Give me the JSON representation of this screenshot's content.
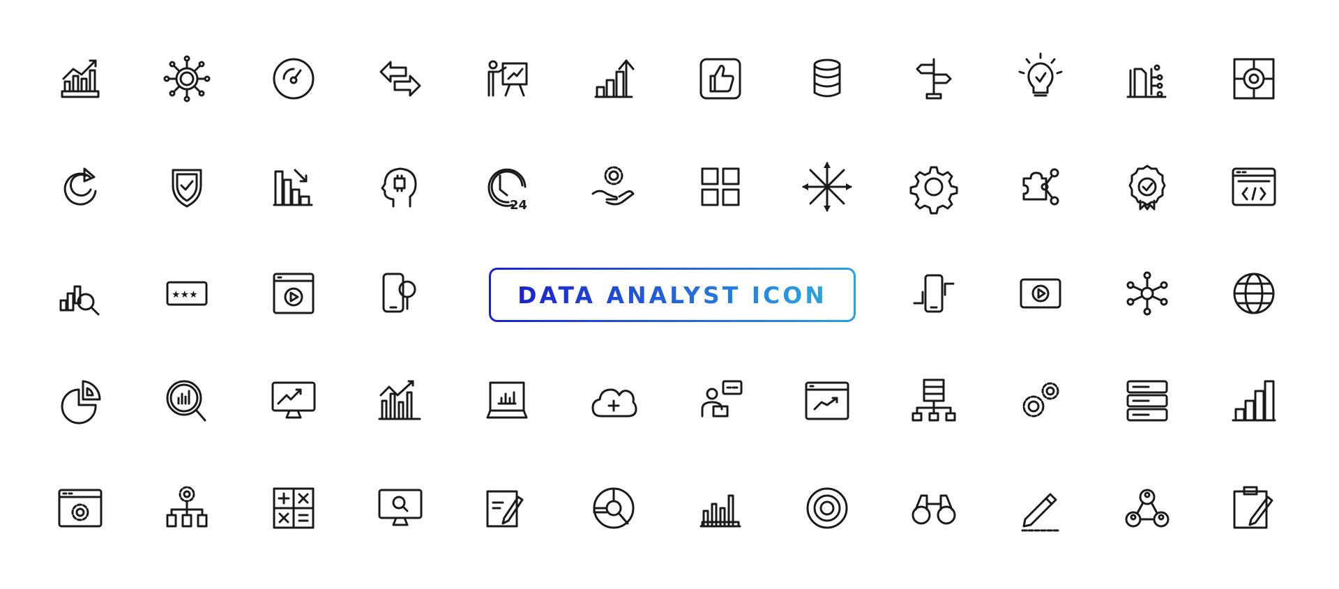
{
  "banner": {
    "title": "DATA ANALYST ICON",
    "gradient_start": "#1a22d0",
    "gradient_end": "#2aa6e3"
  },
  "icon_color": "#1a1a1a",
  "rows": [
    [
      "growth-chart-icon",
      "network-hub-icon",
      "speedometer-icon",
      "exchange-arrows-icon",
      "presentation-icon",
      "bar-growth-icon",
      "thumbs-up-icon",
      "database-icon",
      "signpost-icon",
      "idea-bulb-icon",
      "data-flow-icon",
      "target-frame-icon"
    ],
    [
      "refresh-icon",
      "shield-check-icon",
      "declining-chart-icon",
      "ai-head-icon",
      "support-24-icon",
      "hand-gear-icon",
      "grid-apps-icon",
      "expand-arrows-icon",
      "settings-gear-icon",
      "puzzle-share-icon",
      "quality-badge-icon",
      "code-window-icon"
    ],
    [
      "bar-search-icon",
      "rating-stars-icon",
      "video-window-icon",
      "mobile-search-icon",
      null,
      null,
      null,
      null,
      "mobile-sync-icon",
      "play-button-icon",
      "network-nodes-icon",
      "globe-icon"
    ],
    [
      "pie-chart-icon",
      "chart-search-icon",
      "monitor-chart-icon",
      "bar-trend-icon",
      "laptop-chart-icon",
      "cloud-add-icon",
      "user-chat-icon",
      "browser-chart-icon",
      "hierarchy-icon",
      "gears-icon",
      "server-stack-icon",
      "bar-steps-icon"
    ],
    [
      "browser-settings-icon",
      "gear-hierarchy-icon",
      "calculator-icon",
      "monitor-search-icon",
      "document-edit-icon",
      "donut-chart-icon",
      "bar-chart-icon",
      "target-icon",
      "binoculars-icon",
      "pencil-icon",
      "team-network-icon",
      "clipboard-edit-icon"
    ]
  ],
  "texts": {
    "support_hours": "24",
    "rating_stars": "★★★"
  }
}
